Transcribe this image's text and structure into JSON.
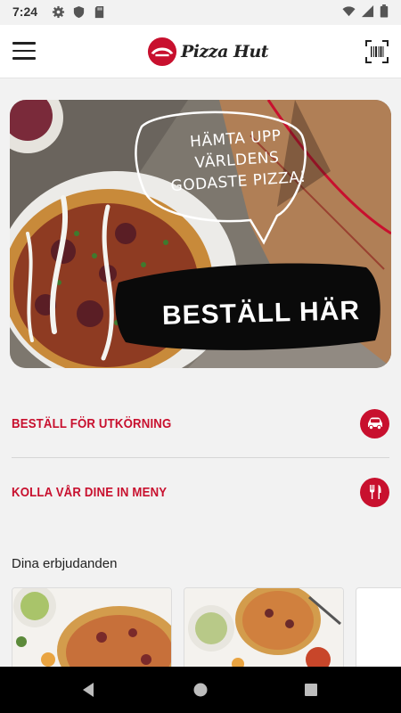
{
  "status_bar": {
    "time": "7:24",
    "icons_left": [
      "gear-icon",
      "shield-icon",
      "sd-card-icon"
    ],
    "icons_right": [
      "wifi-icon",
      "signal-icon",
      "battery-icon"
    ]
  },
  "app_bar": {
    "logo_text": "Pizza Hut",
    "menu_icon": "hamburger-menu-icon",
    "barcode_icon": "barcode-scan-icon"
  },
  "hero": {
    "bubble_text_line1": "HÄMTA UPP VÄRLDENS",
    "bubble_text_line2": "GODASTE PIZZA!",
    "cta": "BESTÄLL HÄR"
  },
  "actions": [
    {
      "label": "BESTÄLL FÖR UTKÖRNING",
      "icon": "car-icon"
    },
    {
      "label": "KOLLA VÅR DINE IN MENY",
      "icon": "cutlery-icon"
    }
  ],
  "offers": {
    "title": "Dina erbjudanden"
  },
  "colors": {
    "brand_red": "#c8102e",
    "background": "#f2f2f2",
    "nav_bar": "#000000"
  },
  "nav_bar": {
    "icons": [
      "back-icon",
      "home-icon",
      "recents-icon"
    ]
  }
}
